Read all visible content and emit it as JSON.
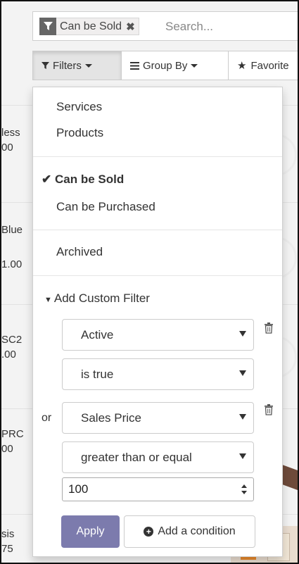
{
  "search": {
    "facet_label": "Can be Sold",
    "placeholder": "Search..."
  },
  "toolbar": {
    "filters_label": "Filters",
    "group_by_label": "Group By",
    "favorites_label": "Favorite"
  },
  "background_list": [
    {
      "name": "less",
      "price": "00"
    },
    {
      "name": "Blue",
      "price": "1.00"
    },
    {
      "name": "SC2",
      "price": ".00"
    },
    {
      "name": "PRC",
      "price": "00"
    },
    {
      "name": "sis",
      "price": "75"
    }
  ],
  "filters_menu": {
    "type_items": [
      "Services",
      "Products"
    ],
    "sale_items": [
      {
        "label": "Can be Sold",
        "checked": true
      },
      {
        "label": "Can be Purchased",
        "checked": false
      }
    ],
    "archived_label": "Archived",
    "custom_filter_label": "Add Custom Filter",
    "conditions": [
      {
        "field": "Active",
        "operator": "is true",
        "prefix": ""
      },
      {
        "field": "Sales Price",
        "operator": "greater than or equal",
        "prefix": "or",
        "value": "100"
      }
    ],
    "apply_label": "Apply",
    "add_condition_label": "Add a condition"
  },
  "colors": {
    "apply_bg": "#7c7bad",
    "facet_icon_bg": "#666666"
  }
}
